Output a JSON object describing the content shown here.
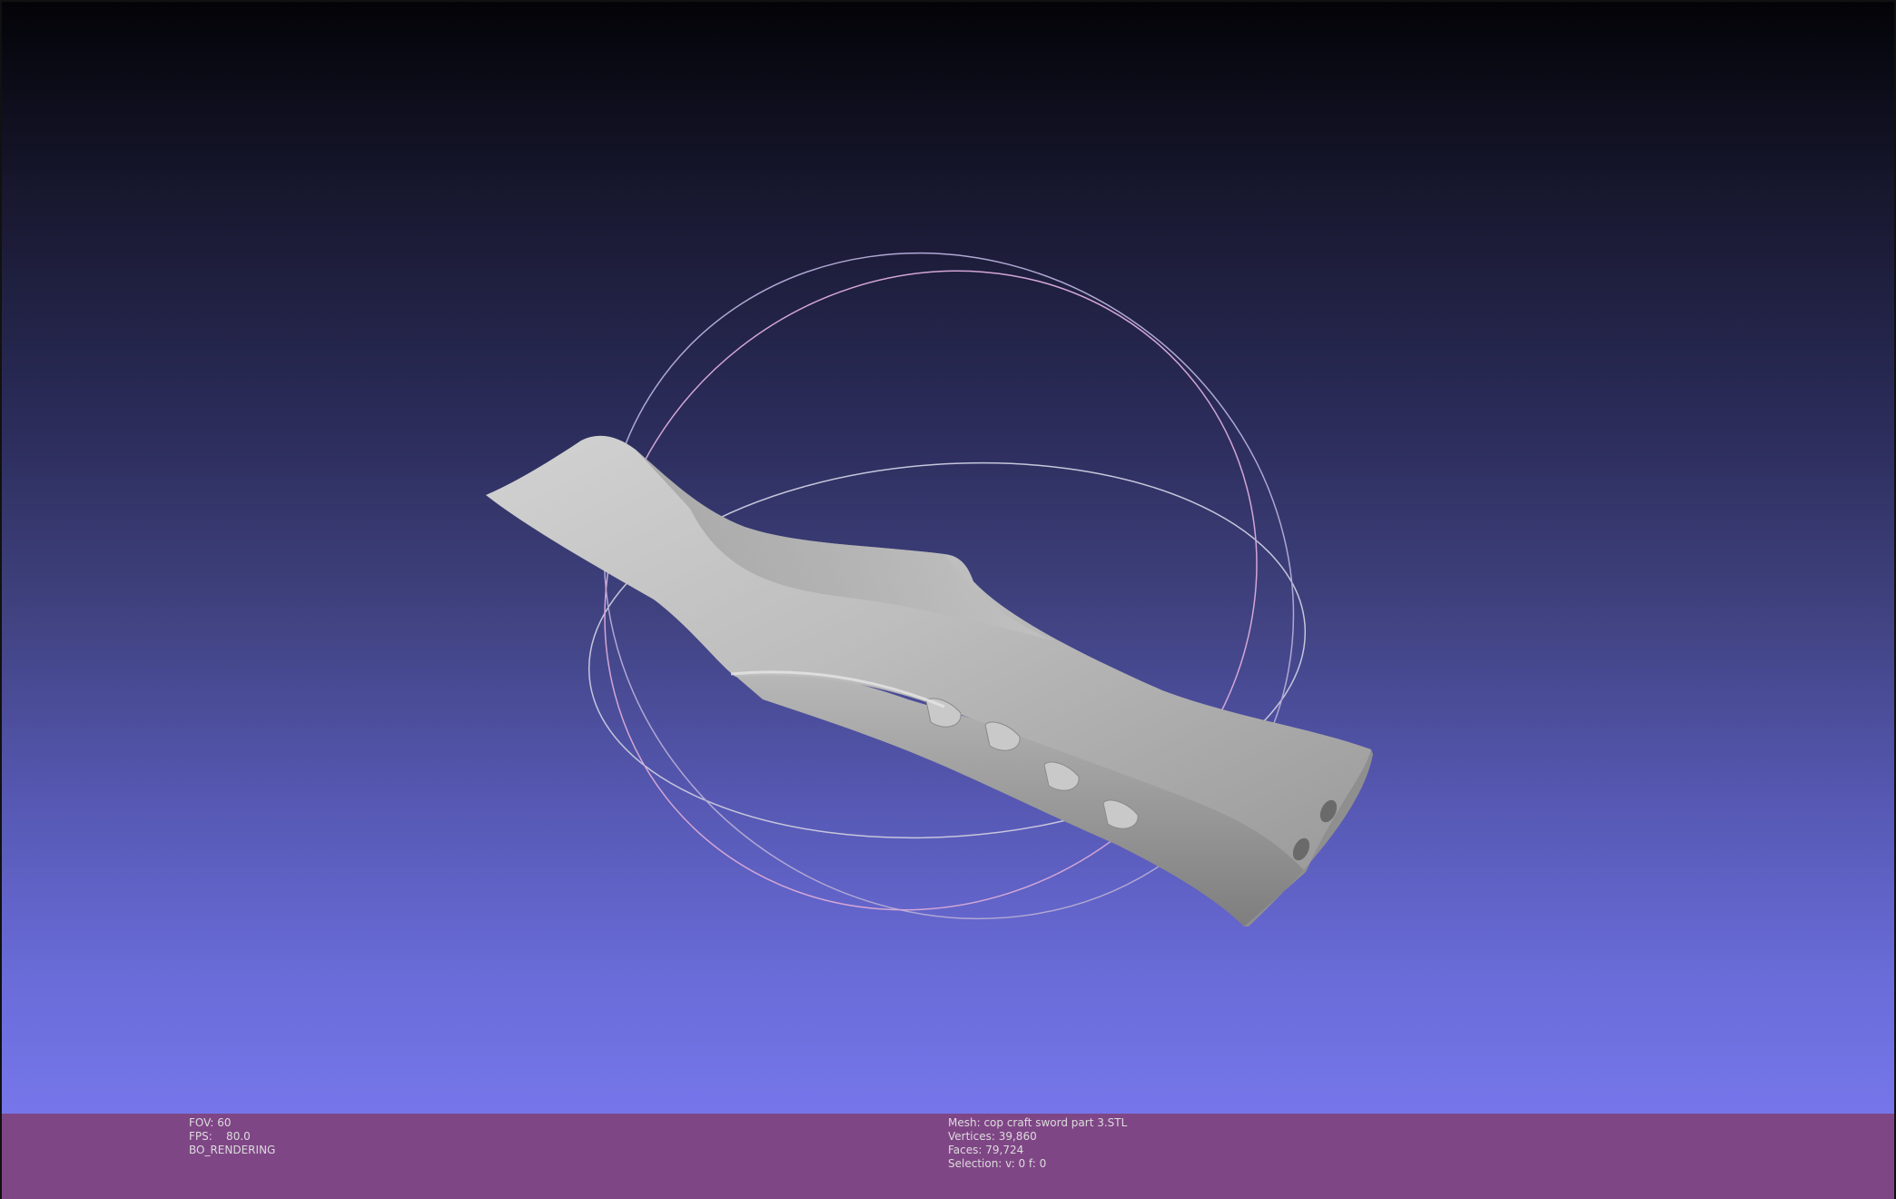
{
  "app": {
    "colors": {
      "background_top": "#030307",
      "background_bottom": "#7676ea",
      "info_bar": "#7f4686",
      "info_text": "#dcdcdc",
      "mesh": "#b4b4b4"
    }
  },
  "info_left": {
    "fov": "FOV: 60",
    "fps": "FPS:    80.0",
    "render_mode": "BO_RENDERING"
  },
  "info_right": {
    "mesh": "Mesh: cop craft sword part 3.STL",
    "vertices": "Vertices: 39,860",
    "faces": "Faces: 79,724",
    "selection": "Selection: v: 0 f: 0"
  }
}
